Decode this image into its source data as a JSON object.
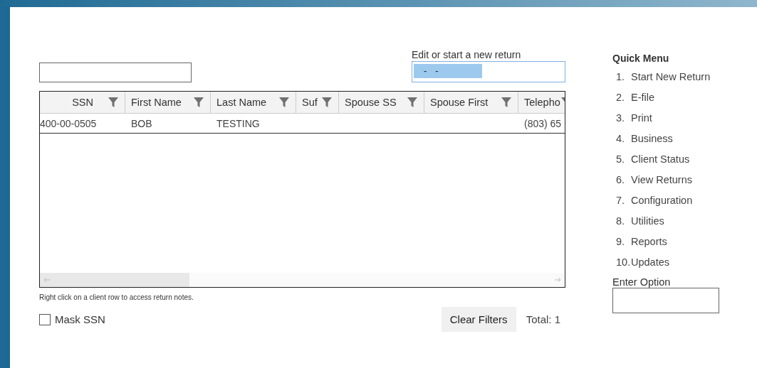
{
  "return_field": {
    "label": "Edit or start a new return",
    "value": "  -   -"
  },
  "table": {
    "columns": [
      {
        "label": "SSN"
      },
      {
        "label": "First Name"
      },
      {
        "label": "Last Name"
      },
      {
        "label": "Suf"
      },
      {
        "label": "Spouse SS"
      },
      {
        "label": "Spouse First"
      },
      {
        "label": "Telepho"
      }
    ],
    "rows": [
      {
        "cells": [
          "400-00-0505",
          "BOB",
          "TESTING",
          null,
          null,
          null,
          "(803) 65"
        ]
      }
    ]
  },
  "note": "Right click on a client row to access return notes.",
  "mask_ssn": {
    "label": "Mask SSN",
    "checked": false
  },
  "clear_button": "Clear Filters",
  "total": "Total: 1",
  "quick_menu": {
    "title": "Quick Menu",
    "items": [
      {
        "number": "1.",
        "label": "Start New Return"
      },
      {
        "number": "2.",
        "label": "E-file"
      },
      {
        "number": "3.",
        "label": "Print"
      },
      {
        "number": "4.",
        "label": "Business"
      },
      {
        "number": "5.",
        "label": "Client Status"
      },
      {
        "number": "6.",
        "label": "View Returns"
      },
      {
        "number": "7.",
        "label": "Configuration"
      },
      {
        "number": "8.",
        "label": "Utilities"
      },
      {
        "number": "9.",
        "label": "Reports"
      },
      {
        "number": "10.",
        "label": "Updates"
      }
    ],
    "option_label": "Enter Option"
  }
}
